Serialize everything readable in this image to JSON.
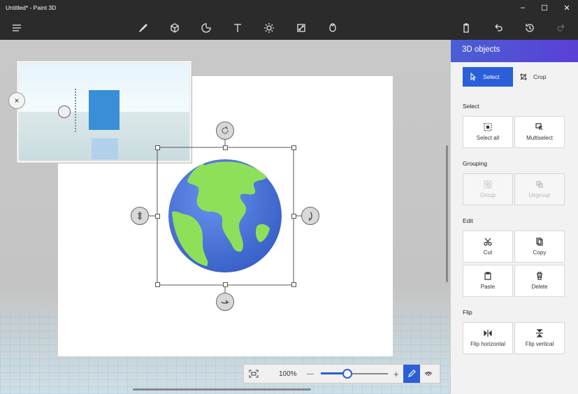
{
  "window": {
    "title": "Untitled* - Paint 3D",
    "minimize": "–",
    "maximize": "☐",
    "close": "✕"
  },
  "toolbar": {
    "menu_icon": "hamburger-icon",
    "tools": [
      "brushes-icon",
      "3d-shapes-icon",
      "stickers-icon",
      "text-icon",
      "effects-icon",
      "canvas-icon",
      "3d-library-icon"
    ],
    "right": [
      "paste-icon",
      "undo-icon",
      "history-icon",
      "redo-icon"
    ]
  },
  "preview": {
    "close": "×"
  },
  "zoom": {
    "percent": "100%",
    "minus": "—",
    "plus": "+",
    "level": 0.4
  },
  "panel": {
    "title": "3D objects",
    "modes": {
      "select": "Select",
      "crop": "Crop"
    },
    "sections": {
      "select": {
        "title": "Select",
        "items": [
          "Select all",
          "Multiselect"
        ]
      },
      "grouping": {
        "title": "Grouping",
        "items": [
          "Group",
          "Ungroup"
        ]
      },
      "edit": {
        "title": "Edit",
        "items": [
          "Cut",
          "Copy",
          "Paste",
          "Delete"
        ]
      },
      "flip": {
        "title": "Flip",
        "items": [
          "Flip horizontal",
          "Flip vertical"
        ]
      }
    }
  },
  "colors": {
    "accent": "#2b5fd9",
    "panel_header": "#4a5fd4",
    "globe_ocean": "#4a74d8",
    "globe_land": "#8ee05a"
  }
}
